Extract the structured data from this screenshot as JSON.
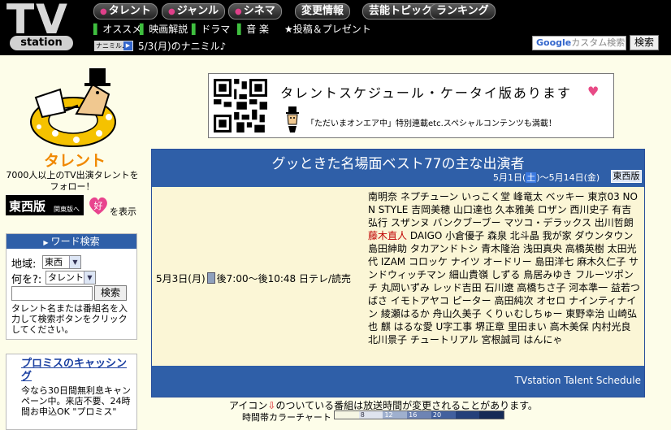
{
  "header": {
    "logo_main": "TV",
    "logo_sub": "station",
    "nav": [
      "タレント",
      "ジャンル",
      "シネマ",
      "変更情報",
      "芸能トピックス",
      "ランキング"
    ],
    "subnav": [
      "オススメ",
      "映画解説",
      "ドラマ",
      "音 楽"
    ],
    "subnav_extra": "★投稿＆プレゼント",
    "today_badge": "ナニミル♪",
    "today_text": "5/3(月)のナニミル♪",
    "search_placeholder_brand": "Google",
    "search_placeholder": "カスタム検索",
    "search_button": "検索"
  },
  "sidebar": {
    "title": "タレント",
    "desc": "7000人以上のTV出演タレントをフォロー！",
    "edition_big": "東西版",
    "edition_small": "関東版へ",
    "fav_text": "を表示",
    "word_search": {
      "heading": "ワード検索",
      "region_label": "地域:",
      "region_value": "東西",
      "what_label": "何を?:",
      "what_value": "タレント",
      "button": "検索",
      "help": "タレント名または番組名を入力して検索ボタンをクリックしてください。"
    },
    "ad": {
      "title": "プロミスのキャッシング",
      "body": "今なら30日間無利息キャンペーン中。来店不要、24時間お申込OK \"プロミス\""
    }
  },
  "banner": {
    "title": "タレントスケジュール・ケータイ版あります",
    "sub": "「ただいまオンエア中」特別連載etc.スペシャルコンテンツも満載！"
  },
  "main": {
    "title": "グッときた名場面ベスト77の主な出演者",
    "dates_pre": "5月1日(",
    "dates_hl": "土",
    "dates_post": ")〜5月14日(金)",
    "region": "東西版",
    "slot_date": "5月3日(月)",
    "slot_time": "後7:00〜後10:48 日テレ/読売",
    "cast_a": "南明奈 ネプチューン いっこく堂 峰竜太 ベッキー 東京03 NON STYLE 吉岡美穂 山口達也 久本雅美 ロザン 西川史子 有吉弘行 スザンヌ バンクブーブー マツコ・デラックス 出川哲朗 ",
    "cast_hl": "藤木直人",
    "cast_b": " DAIGO 小倉優子 森泉 北斗晶 我が家 ダウンタウン 島田紳助 タカアンドトシ 青木隆治 浅田真央 高橋英樹 太田光代 IZAM コロッケ ナイツ オードリー 島田洋七 麻木久仁子 サンドウィッチマン 細山貴嶺 しずる 鳥居みゆき フルーツポンチ 丸岡いずみ レッド吉田 石川遼 高橋ちさ子 河本準一 益若つばさ イモトアヤコ ピーター 高田純次 オセロ ナインティナイン 綾瀬はるか 舟山久美子 くりぃむしちゅー 東野幸治 山崎弘也 麒 はるな愛 U字工事 堺正章 里田まい 高木美保 内村光良 北川景子 チュートリアル 宮根誠司 はんにゃ",
    "footer": "TVstation Talent Schedule"
  },
  "note": {
    "pre": "アイコン",
    "post": "のついている番組は放送時間が変更されることがあります。",
    "legend_label": "時間帯カラーチャート",
    "legend_ticks": [
      "8",
      "12",
      "16",
      "20"
    ],
    "legend_colors": [
      "#f6f6e4",
      "#dfe4ee",
      "#9fb0ce",
      "#6e84b4",
      "#42609e",
      "#24407a",
      "#152a56"
    ]
  }
}
